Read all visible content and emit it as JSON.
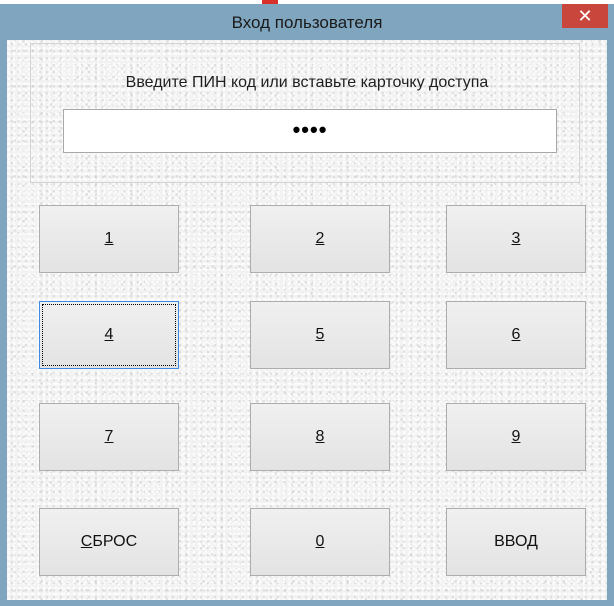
{
  "window": {
    "title": "Вход пользователя",
    "close_glyph": "✕",
    "close_icon": "close-icon"
  },
  "login": {
    "prompt": "Введите ПИН код или вставьте карточку доступа",
    "pin_mask": "••••"
  },
  "keypad": [
    {
      "key": "1",
      "mnemonic": "1",
      "rest": ""
    },
    {
      "key": "2",
      "mnemonic": "2",
      "rest": ""
    },
    {
      "key": "3",
      "mnemonic": "3",
      "rest": ""
    },
    {
      "key": "4",
      "mnemonic": "4",
      "rest": "",
      "focused": true
    },
    {
      "key": "5",
      "mnemonic": "5",
      "rest": ""
    },
    {
      "key": "6",
      "mnemonic": "6",
      "rest": ""
    },
    {
      "key": "7",
      "mnemonic": "7",
      "rest": ""
    },
    {
      "key": "8",
      "mnemonic": "8",
      "rest": ""
    },
    {
      "key": "9",
      "mnemonic": "9",
      "rest": ""
    },
    {
      "key": "reset",
      "mnemonic": "С",
      "rest": "БРОС"
    },
    {
      "key": "0",
      "mnemonic": "0",
      "rest": ""
    },
    {
      "key": "enter",
      "mnemonic": "",
      "rest": "ВВОД"
    }
  ],
  "colors": {
    "frame": "#7fa5bf",
    "close_button": "#c8463c",
    "focus_border": "#3c8be0"
  }
}
